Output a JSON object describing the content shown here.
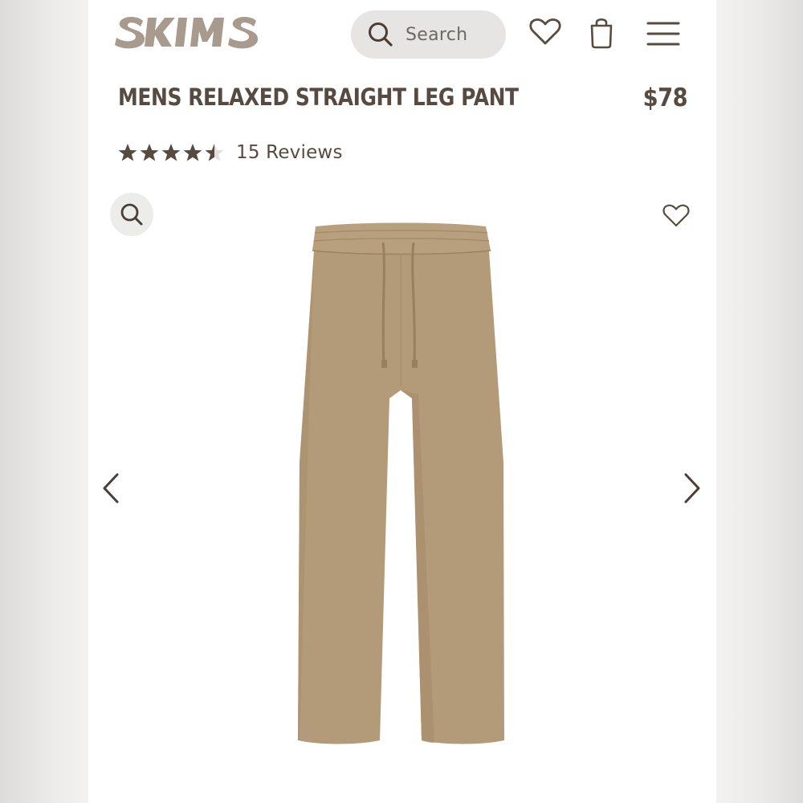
{
  "brand": {
    "name": "SKIMS",
    "color": "#a89a8c"
  },
  "header": {
    "search": {
      "placeholder": "Search",
      "icon": "search-icon"
    },
    "icons": [
      "heart-icon",
      "shopping-bag-icon",
      "menu-icon"
    ]
  },
  "product": {
    "title": "MENS RELAXED STRAIGHT LEG PANT",
    "price": "$78",
    "rating": 4.5,
    "rating_max": 5,
    "reviews_label": "15 Reviews",
    "image_color": "#b39a78"
  },
  "gallery": {
    "zoom_icon": "zoom-search-icon",
    "wishlist_icon": "heart-icon",
    "prev_icon": "chevron-left-icon",
    "next_icon": "chevron-right-icon"
  },
  "colors": {
    "text": "#574a40",
    "icon": "#5a4b3f",
    "search_bg": "#e6e5e3"
  }
}
